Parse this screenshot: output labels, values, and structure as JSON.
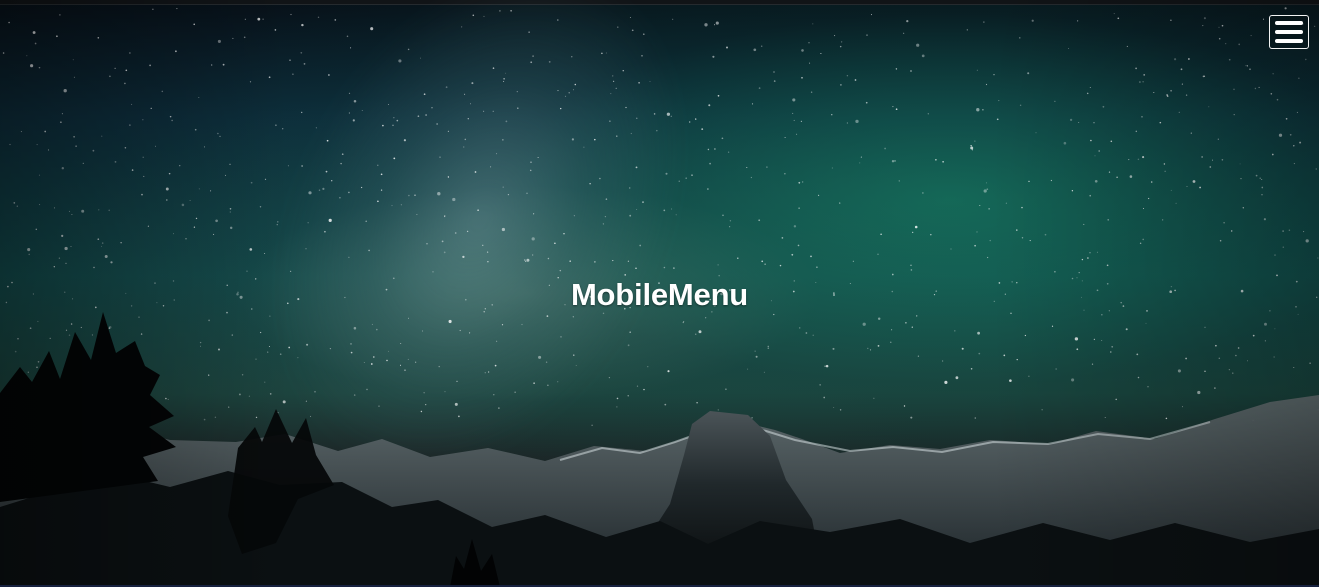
{
  "hero": {
    "title": "MobileMenu",
    "background_icon": "night-sky-mountain-image"
  },
  "navigation": {
    "menu_icon": "hamburger-menu-icon"
  },
  "colors": {
    "text": "#ffffff",
    "sky_teal": "#124a4b",
    "mountain_dark": "#05080b"
  }
}
